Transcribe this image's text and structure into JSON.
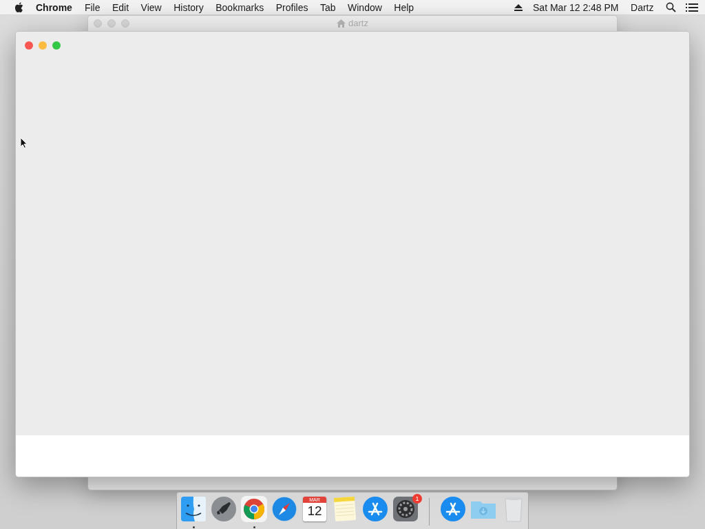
{
  "menu_bar": {
    "app_name": "Chrome",
    "items": [
      "File",
      "Edit",
      "View",
      "History",
      "Bookmarks",
      "Profiles",
      "Tab",
      "Window",
      "Help"
    ],
    "clock": "Sat Mar 12  2:48 PM",
    "user": "Dartz"
  },
  "background_window": {
    "title": "dartz"
  },
  "dock": {
    "items": [
      {
        "kind": "finder",
        "running": true
      },
      {
        "kind": "launchpad",
        "running": false
      },
      {
        "kind": "chrome",
        "running": true
      },
      {
        "kind": "safari",
        "running": false
      },
      {
        "kind": "calendar",
        "running": false,
        "month": "MAR",
        "day": "12"
      },
      {
        "kind": "notes",
        "running": false
      },
      {
        "kind": "appstore",
        "running": false
      },
      {
        "kind": "preferences",
        "running": false,
        "badge": "1"
      },
      {
        "kind": "separator"
      },
      {
        "kind": "appstore",
        "running": false
      },
      {
        "kind": "downloads",
        "running": false
      },
      {
        "kind": "trash",
        "running": false
      }
    ]
  }
}
